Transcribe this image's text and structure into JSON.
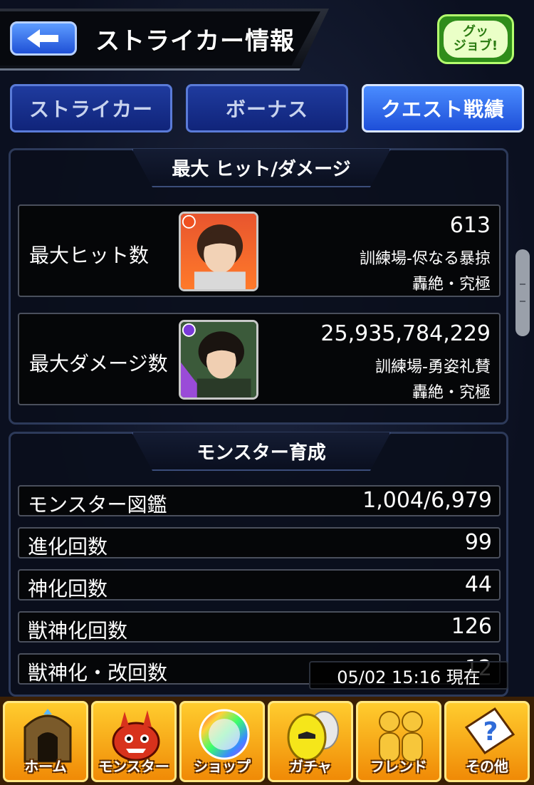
{
  "header": {
    "title": "ストライカー情報",
    "goodjob_label_1": "グッ",
    "goodjob_label_2": "ジョブ!"
  },
  "tabs": [
    {
      "label": "ストライカー",
      "active": false
    },
    {
      "label": "ボーナス",
      "active": false
    },
    {
      "label": "クエスト戦績",
      "active": true
    }
  ],
  "max_section": {
    "title": "最大 ヒット/ダメージ",
    "hit": {
      "label": "最大ヒット数",
      "value": "613",
      "quest": "訓練場-侭なる暴掠",
      "difficulty": "轟絶・究極"
    },
    "damage": {
      "label": "最大ダメージ数",
      "value": "25,935,784,229",
      "quest": "訓練場-勇姿礼賛",
      "difficulty": "轟絶・究極"
    }
  },
  "monster_section": {
    "title": "モンスター育成",
    "rows": [
      {
        "label": "モンスター図鑑",
        "value": "1,004/6,979"
      },
      {
        "label": "進化回数",
        "value": "99"
      },
      {
        "label": "神化回数",
        "value": "44"
      },
      {
        "label": "獣神化回数",
        "value": "126"
      },
      {
        "label": "獣神化・改回数",
        "value": "12"
      }
    ]
  },
  "timestamp": "05/02 15:16 現在",
  "bottom_nav": [
    {
      "label": "ホーム",
      "icon": "home-gate-icon"
    },
    {
      "label": "モンスター",
      "icon": "monster-icon"
    },
    {
      "label": "ショップ",
      "icon": "rainbow-orb-icon"
    },
    {
      "label": "ガチャ",
      "icon": "gacha-egg-icon"
    },
    {
      "label": "フレンド",
      "icon": "friends-icon"
    },
    {
      "label": "その他",
      "icon": "question-icon"
    }
  ],
  "colors": {
    "tab_active": "#2e6cf0",
    "tab_inactive": "#14318c",
    "nav_gold": "#f5a91a"
  }
}
